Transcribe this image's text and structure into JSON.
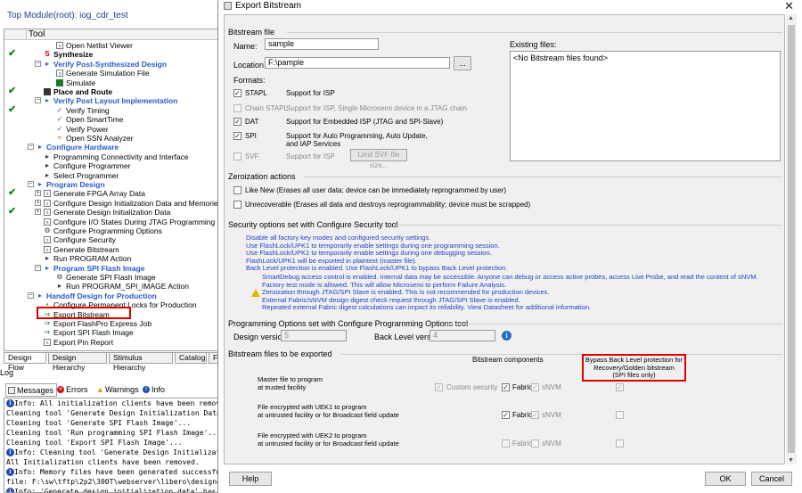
{
  "app": {
    "top_module": "Top Module(root): iog_cdr_test",
    "tool_header": "Tool",
    "tree": [
      {
        "label": "Open Netlist Viewer",
        "level": 3,
        "check": false,
        "expander": "",
        "icon": "doc",
        "style": ""
      },
      {
        "label": "Synthesize",
        "level": 2,
        "check": true,
        "expander": "",
        "icon": "synth",
        "style": "bold"
      },
      {
        "label": "Verify Post-Synthesized Design",
        "level": 2,
        "check": false,
        "expander": "−",
        "icon": "arrow",
        "style": "section"
      },
      {
        "label": "Generate Simulation File",
        "level": 3,
        "check": false,
        "expander": "",
        "icon": "doc",
        "style": ""
      },
      {
        "label": "Simulate",
        "level": 3,
        "check": false,
        "expander": "",
        "icon": "sim",
        "style": ""
      },
      {
        "label": "Place and Route",
        "level": 2,
        "check": true,
        "expander": "",
        "icon": "chip",
        "style": "bold"
      },
      {
        "label": "Verify Post Layout Implementation",
        "level": 2,
        "check": false,
        "expander": "−",
        "icon": "arrow",
        "style": "section"
      },
      {
        "label": "Verify Timing",
        "level": 3,
        "check": true,
        "expander": "",
        "icon": "timing",
        "style": ""
      },
      {
        "label": "Open SmartTime",
        "level": 3,
        "check": false,
        "expander": "",
        "icon": "timing",
        "style": ""
      },
      {
        "label": "Verify Power",
        "level": 3,
        "check": false,
        "expander": "",
        "icon": "power",
        "style": ""
      },
      {
        "label": "Open SSN Analyzer",
        "level": 3,
        "check": false,
        "expander": "",
        "icon": "ssn",
        "style": ""
      },
      {
        "label": "Configure Hardware",
        "level": 1,
        "check": false,
        "expander": "−",
        "icon": "arrow",
        "style": "section"
      },
      {
        "label": "Programming Connectivity and Interface",
        "level": 2,
        "check": false,
        "expander": "",
        "icon": "prog",
        "style": ""
      },
      {
        "label": "Configure Programmer",
        "level": 2,
        "check": false,
        "expander": "",
        "icon": "prog",
        "style": ""
      },
      {
        "label": "Select Programmer",
        "level": 2,
        "check": false,
        "expander": "",
        "icon": "prog",
        "style": ""
      },
      {
        "label": "Program Design",
        "level": 1,
        "check": false,
        "expander": "−",
        "icon": "arrow",
        "style": "section"
      },
      {
        "label": "Generate FPGA Array Data",
        "level": 2,
        "check": true,
        "expander": "+",
        "icon": "doc",
        "style": ""
      },
      {
        "label": "Configure Design Initialization Data and Memories",
        "level": 2,
        "check": false,
        "expander": "+",
        "icon": "doc",
        "style": ""
      },
      {
        "label": "Generate Design Initialization Data",
        "level": 2,
        "check": true,
        "expander": "+",
        "icon": "doc",
        "style": ""
      },
      {
        "label": "Configure I/O States During JTAG Programming",
        "level": 2,
        "check": false,
        "expander": "",
        "icon": "doc",
        "style": ""
      },
      {
        "label": "Configure Programming Options",
        "level": 2,
        "check": false,
        "expander": "",
        "icon": "gear",
        "style": ""
      },
      {
        "label": "Configure Security",
        "level": 2,
        "check": false,
        "expander": "",
        "icon": "doc",
        "style": ""
      },
      {
        "label": "Generate Bitstream",
        "level": 2,
        "check": false,
        "expander": "",
        "icon": "doc",
        "style": ""
      },
      {
        "label": "Run PROGRAM Action",
        "level": 2,
        "check": false,
        "expander": "",
        "icon": "prog",
        "style": ""
      },
      {
        "label": "Program SPI Flash Image",
        "level": 2,
        "check": false,
        "expander": "−",
        "icon": "arrow",
        "style": "section"
      },
      {
        "label": "Generate SPI Flash Image",
        "level": 3,
        "check": false,
        "expander": "",
        "icon": "gear",
        "style": ""
      },
      {
        "label": "Run PROGRAM_SPI_IMAGE Action",
        "level": 3,
        "check": false,
        "expander": "",
        "icon": "prog",
        "style": ""
      },
      {
        "label": "Handoff Design for Production",
        "level": 1,
        "check": false,
        "expander": "−",
        "icon": "arrow",
        "style": "section"
      },
      {
        "label": "Configure Permanent Locks for Production",
        "level": 2,
        "check": false,
        "expander": "",
        "icon": "lock",
        "style": ""
      },
      {
        "label": "Export Bitstream",
        "level": 2,
        "check": false,
        "expander": "",
        "icon": "export",
        "style": ""
      },
      {
        "label": "Export FlashPro Express Job",
        "level": 2,
        "check": false,
        "expander": "",
        "icon": "export",
        "style": ""
      },
      {
        "label": "Export SPI Flash Image",
        "level": 2,
        "check": false,
        "expander": "",
        "icon": "export",
        "style": ""
      },
      {
        "label": "Export Pin Report",
        "level": 2,
        "check": false,
        "expander": "",
        "icon": "doc",
        "style": ""
      }
    ],
    "bottom_tabs": [
      "Design Flow",
      "Design Hierarchy",
      "Stimulus Hierarchy",
      "Catalog",
      "F"
    ],
    "log_label": "Log",
    "log_tabs": [
      "Messages",
      "Errors",
      "Warnings",
      "Info"
    ],
    "log_lines": [
      {
        "info": true,
        "text": "Info: All initialization clients have been remove"
      },
      {
        "info": false,
        "text": "Cleaning tool 'Generate Design Initialization Data'"
      },
      {
        "info": false,
        "text": "Cleaning tool 'Generate SPI Flash Image'..."
      },
      {
        "info": false,
        "text": "Cleaning tool 'Run programming SPI Flash Image'..."
      },
      {
        "info": false,
        "text": "Cleaning tool 'Export SPI Flash Image'..."
      },
      {
        "info": true,
        "text": "Info: Cleaning tool 'Generate Design Initializati"
      },
      {
        "info": false,
        "text": "     All Initialization clients have been removed."
      },
      {
        "info": true,
        "text": "Info: Memory files have been generated successful"
      },
      {
        "info": false,
        "text": "file: F:\\sw\\tftp\\2p2\\300T\\webserver\\libero\\designer"
      },
      {
        "info": true,
        "text": "Info: 'Generate design initialization data' has c"
      }
    ]
  },
  "dialog": {
    "title": "Export Bitstream",
    "close_glyph": "✕",
    "bitstream_file_section": "Bitstream file",
    "name_label": "Name:",
    "name_value": "sample",
    "location_label": "Location:",
    "location_value": "F:\\pample",
    "browse_label": "...",
    "existing_files_label": "Existing files:",
    "existing_files_value": "<No Bitstream files found>",
    "formats_label": "Formats:",
    "formats": [
      {
        "name": "STAPL",
        "checked": true,
        "enabled": true,
        "desc": "Support for ISP"
      },
      {
        "name": "Chain STAPL",
        "checked": false,
        "enabled": false,
        "desc": "Support for ISP,  Single Microsemi device in a JTAG chain"
      },
      {
        "name": "DAT",
        "checked": true,
        "enabled": true,
        "desc": "Support for Embedded ISP (JTAG and SPI-Slave)"
      },
      {
        "name": "SPI",
        "checked": true,
        "enabled": true,
        "desc": "Support for Auto Programming, Auto Update,\nand IAP Services"
      },
      {
        "name": "SVF",
        "checked": false,
        "enabled": false,
        "desc": "Support for ISP"
      }
    ],
    "limit_svf_button": "Limit SVF file size...",
    "zeroization_section": "Zeroization actions",
    "zeroization_options": [
      "Like New (Erases all user data; device can be immediately reprogrammed by user)",
      "Unrecoverable (Erases all data and destroys reprogrammability; device must be scrapped)"
    ],
    "security_section": "Security options set with Configure Security tool",
    "security_lines": [
      "Disable all factory key modes and configured security settings.",
      "Use FlashLock/UPK1 to temporarily enable settings during one programming session.",
      "Use FlashLock/UPK1 to temporarily enable settings during one debugging session.",
      "FlashLock/UPK1 will be exported in plaintext (master file).",
      "Back Level protection is enabled. Use FlashLock/UPK1 to bypass Back Level protection."
    ],
    "security_warning_lines": [
      "SmartDebug access control is enabled. Internal data may be accessible. Anyone can debug or access active probes, access Live Probe, and read the content of sNVM.",
      "Factory test mode is allowed. This will allow Microsemi to perform Failure Analysis.",
      "Zeroization through JTAG/SPI Slave is enabled. This is not recommended for production devices.",
      "External Fabric/sNVM design digest check request through JTAG/SPI Slave is enabled.",
      "Repeated external Fabric digest calculations can impact its reliability. View Datasheet for additional information."
    ],
    "programming_section": "Programming Options set with Configure Programming Options tool",
    "design_version_label": "Design version:",
    "design_version_value": "5",
    "back_level_label": "Back Level version:",
    "back_level_value": "4",
    "files_section": "Bitstream files to be exported",
    "components_header": "Bitstream components",
    "bypass_header": "Bypass Back Level protection for\nRecovery/Golden bitstream\n(SPI files only)",
    "file_rows": [
      {
        "desc": "Master file to program\nat trusted facility",
        "custom": "Custom security",
        "custom_checked": true,
        "fabric_checked": true,
        "fabric_enabled": true,
        "snvm_checked": true,
        "bypass_checked": true
      },
      {
        "desc": "File encrypted with UEK1 to program\nat untrusted facility or for Broadcast field update",
        "custom": "",
        "custom_checked": false,
        "fabric_checked": true,
        "fabric_enabled": true,
        "snvm_checked": true,
        "bypass_checked": false
      },
      {
        "desc": "File encrypted with UEK2 to program\nat untrusted facility or for Broadcast field update",
        "custom": "",
        "custom_checked": false,
        "fabric_checked": false,
        "fabric_enabled": false,
        "snvm_checked": false,
        "bypass_checked": false
      }
    ],
    "fabric_label": "Fabric",
    "snvm_label": "sNVM",
    "help_button": "Help",
    "ok_button": "OK",
    "cancel_button": "Cancel",
    "colors": {
      "section_blue": "#2b5ac8",
      "highlight_red": "#e00000",
      "security_blue": "#2243c4",
      "check_green": "#0f8a1a"
    }
  }
}
